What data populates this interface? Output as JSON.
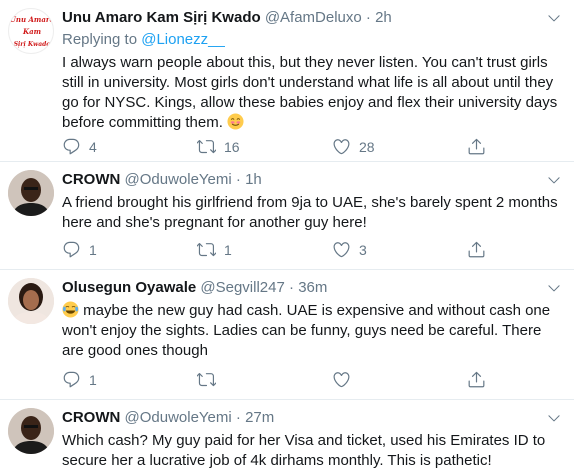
{
  "tweets": [
    {
      "name": "Unu Amaro Kam Sịrị Kwado",
      "handle": "@AfamDeluxo",
      "dot": "·",
      "time": "2h",
      "replying_prefix": "Replying to ",
      "replying_to": "@Lionezz__",
      "text": "I always warn people about this, but they never listen. You can't trust girls still in university. Most girls don't understand what life is all about until they go for NYSC. Kings, allow these babies enjoy and flex their university days before committing them.",
      "avatar_text": [
        "Unu Amaro",
        "Kam",
        "Sịrị Kwado"
      ],
      "replies": "4",
      "retweets": "16",
      "likes": "28"
    },
    {
      "name": "CROWN",
      "handle": "@OduwoleYemi",
      "dot": "·",
      "time": "1h",
      "text": "A friend brought his girlfriend from 9ja to UAE,  she's barely spent 2 months here and she's pregnant for another guy here!",
      "replies": "1",
      "retweets": "1",
      "likes": "3"
    },
    {
      "name": "Olusegun Oyawale",
      "handle": "@Segvill247",
      "dot": "·",
      "time": "36m",
      "text": "maybe the new guy had cash. UAE is expensive and without cash one won't enjoy the sights. Ladies can be funny, guys need be careful. There are good ones though",
      "replies": "1",
      "retweets": "",
      "likes": ""
    },
    {
      "name": "CROWN",
      "handle": "@OduwoleYemi",
      "dot": "·",
      "time": "27m",
      "text": "Which cash? My guy paid for her Visa and ticket, used his Emirates ID to secure her a lucrative job of 4k dirhams monthly. This is pathetic!"
    }
  ],
  "icons": {
    "reply": "reply-icon",
    "retweet": "retweet-icon",
    "like": "heart-icon",
    "share": "share-icon",
    "menu": "chevron-down-icon"
  },
  "colors": {
    "link": "#1da1f2",
    "secondary": "#657786",
    "divider": "#e6ecf0"
  }
}
